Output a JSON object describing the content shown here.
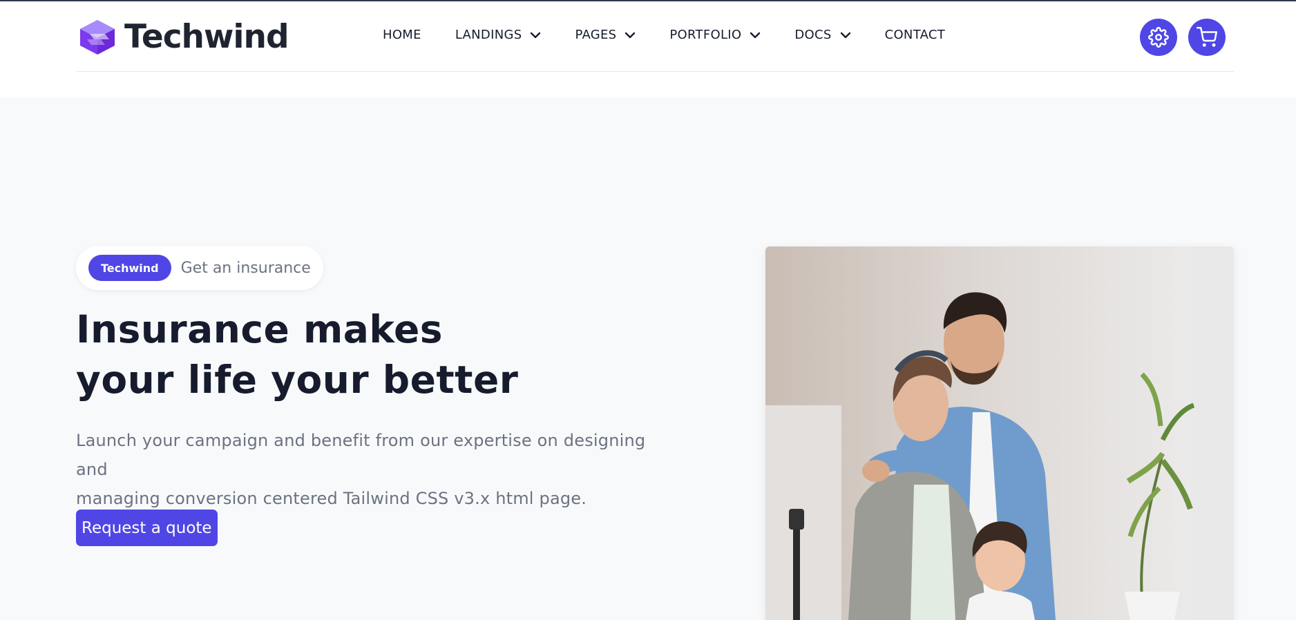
{
  "brand": {
    "name": "Techwind",
    "accent_color": "#4f46e5"
  },
  "nav": {
    "items": [
      {
        "label": "HOME",
        "has_dropdown": false
      },
      {
        "label": "LANDINGS",
        "has_dropdown": true
      },
      {
        "label": "PAGES",
        "has_dropdown": true
      },
      {
        "label": "PORTFOLIO",
        "has_dropdown": true
      },
      {
        "label": "DOCS",
        "has_dropdown": true
      },
      {
        "label": "CONTACT",
        "has_dropdown": false
      }
    ]
  },
  "header_actions": {
    "settings_icon": "gear-icon",
    "cart_icon": "shopping-cart-icon"
  },
  "hero": {
    "badge": "Techwind",
    "badge_text": "Get an insurance",
    "title_line1": "Insurance makes",
    "title_line2": "your life your better",
    "description_line1": "Launch your campaign and benefit from our expertise on designing and",
    "description_line2": "managing conversion centered Tailwind CSS v3.x html page.",
    "cta_label": "Request a quote"
  }
}
